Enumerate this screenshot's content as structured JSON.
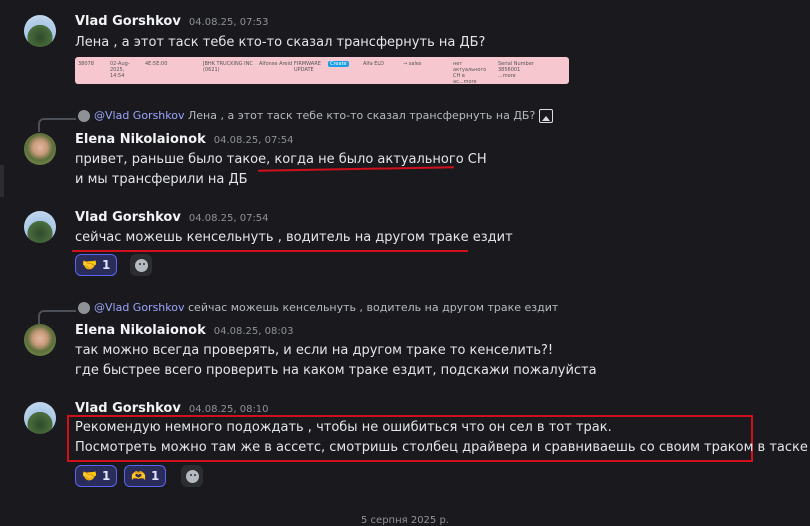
{
  "messages": [
    {
      "author": "Vlad Gorshkov",
      "time": "04.08.25, 07:53",
      "lines": [
        "Лена , а этот таск тебе кто-то сказал трансфернуть на ДБ?"
      ],
      "preview_cells": [
        "38078",
        "02-Aug-2025, 14:54",
        "4E:5E:00",
        "JBHK TRUCKING INC (0621)",
        "Alfonse Areid",
        "FIRMWARE UPDATE",
        "Create",
        "Alfa ELD",
        "→ sales",
        "нет актуального CH в ас...more",
        "Serial Number 3856001 ...more"
      ]
    },
    {
      "reply_to_author": "@Vlad Gorshkov",
      "reply_to_text": "Лена , а этот таск тебе кто-то сказал трансфернуть на ДБ?",
      "author": "Elena Nikolaionok",
      "time": "04.08.25, 07:54",
      "lines": [
        "привет, раньше было такое, когда не было актуального СН",
        "и мы трансферили на ДБ"
      ]
    },
    {
      "author": "Vlad Gorshkov",
      "time": "04.08.25, 07:54",
      "lines": [
        "сейчас можешь кенсельнуть , водитель на другом траке ездит"
      ],
      "reactions": [
        {
          "emoji": "🤝",
          "count": "1"
        }
      ]
    },
    {
      "reply_to_author": "@Vlad Gorshkov",
      "reply_to_text": "сейчас можешь кенсельнуть , водитель на другом траке ездит",
      "author": "Elena Nikolaionok",
      "time": "04.08.25, 08:03",
      "lines": [
        "так можно всегда проверять, и если на другом траке то кенселить?!",
        "где быстрее всего проверить на каком траке ездит, подскажи пожалуйста"
      ]
    },
    {
      "author": "Vlad Gorshkov",
      "time": "04.08.25, 08:10",
      "lines": [
        "Рекомендую немного подождать , чтобы не ошибиться что он сел в тот трак.",
        "Посмотреть можно там же в ассетс, смотришь столбец драйвера и сравниваешь со своим траком в таске"
      ],
      "reactions": [
        {
          "emoji": "🤝",
          "count": "1"
        },
        {
          "emoji": "🫶",
          "count": "1"
        }
      ]
    }
  ],
  "date_divider": "5 серпня 2025 р.",
  "colors": {
    "accent": "#5865f2",
    "highlight": "#d0101a",
    "background": "#1a1a1e"
  },
  "icons": [
    "image-icon",
    "add-reaction-icon"
  ]
}
